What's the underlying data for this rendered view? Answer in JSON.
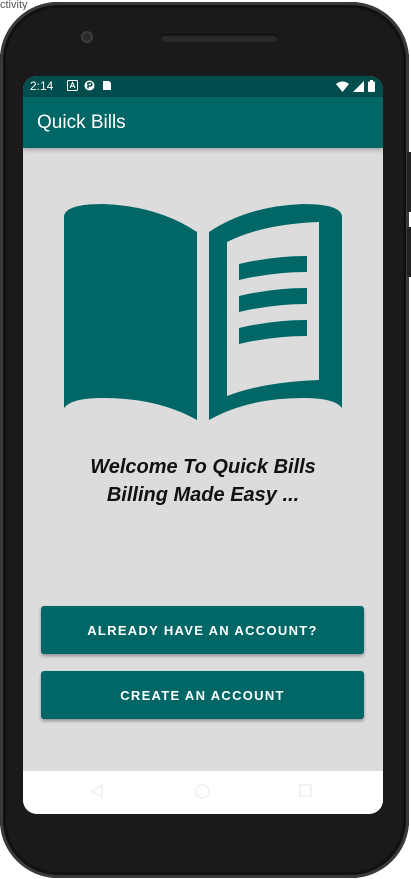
{
  "status_bar": {
    "time": "2:14"
  },
  "app_bar": {
    "title": "Quick Bills"
  },
  "welcome": {
    "line1": "Welcome To Quick Bills",
    "line2": "Billing Made Easy ..."
  },
  "buttons": {
    "login_label": "ALREADY HAVE AN ACCOUNT?",
    "signup_label": "CREATE AN ACCOUNT"
  },
  "colors": {
    "primary": "#006666",
    "primary_dark": "#004d4d",
    "background": "#dcdcdc"
  },
  "icons": [
    "book-logo-icon",
    "wifi-icon",
    "signal-icon",
    "battery-icon",
    "back-icon",
    "home-icon",
    "recents-icon"
  ]
}
